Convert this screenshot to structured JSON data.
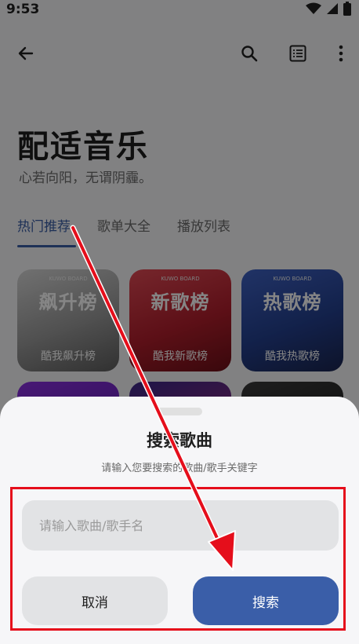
{
  "status": {
    "time": "9:53"
  },
  "header": {
    "title": "配适音乐",
    "subtitle": "心若向阳，无谓阴霾。"
  },
  "tabs": [
    {
      "label": "热门推荐",
      "active": true
    },
    {
      "label": "歌单大全",
      "active": false
    },
    {
      "label": "播放列表",
      "active": false
    }
  ],
  "cards": [
    {
      "big": "飙升榜",
      "small": "KUWO BOARD",
      "label": "酷我飙升榜"
    },
    {
      "big": "新歌榜",
      "small": "KUWO BOARD",
      "label": "酷我新歌榜"
    },
    {
      "big": "热歌榜",
      "small": "KUWO BOARD",
      "label": "酷我热歌榜"
    }
  ],
  "dialog": {
    "title": "搜索歌曲",
    "subtitle": "请输入您要搜索的歌曲/歌手关键字",
    "input_placeholder": "请输入歌曲/歌手名",
    "input_value": "",
    "cancel_label": "取消",
    "search_label": "搜索"
  },
  "colors": {
    "accent": "#3a5ea8",
    "annotation_red": "#e50e1b"
  },
  "icons": [
    "back-arrow-icon",
    "search-icon",
    "list-icon",
    "more-vertical-icon",
    "wifi-icon",
    "signal-icon",
    "battery-icon"
  ]
}
